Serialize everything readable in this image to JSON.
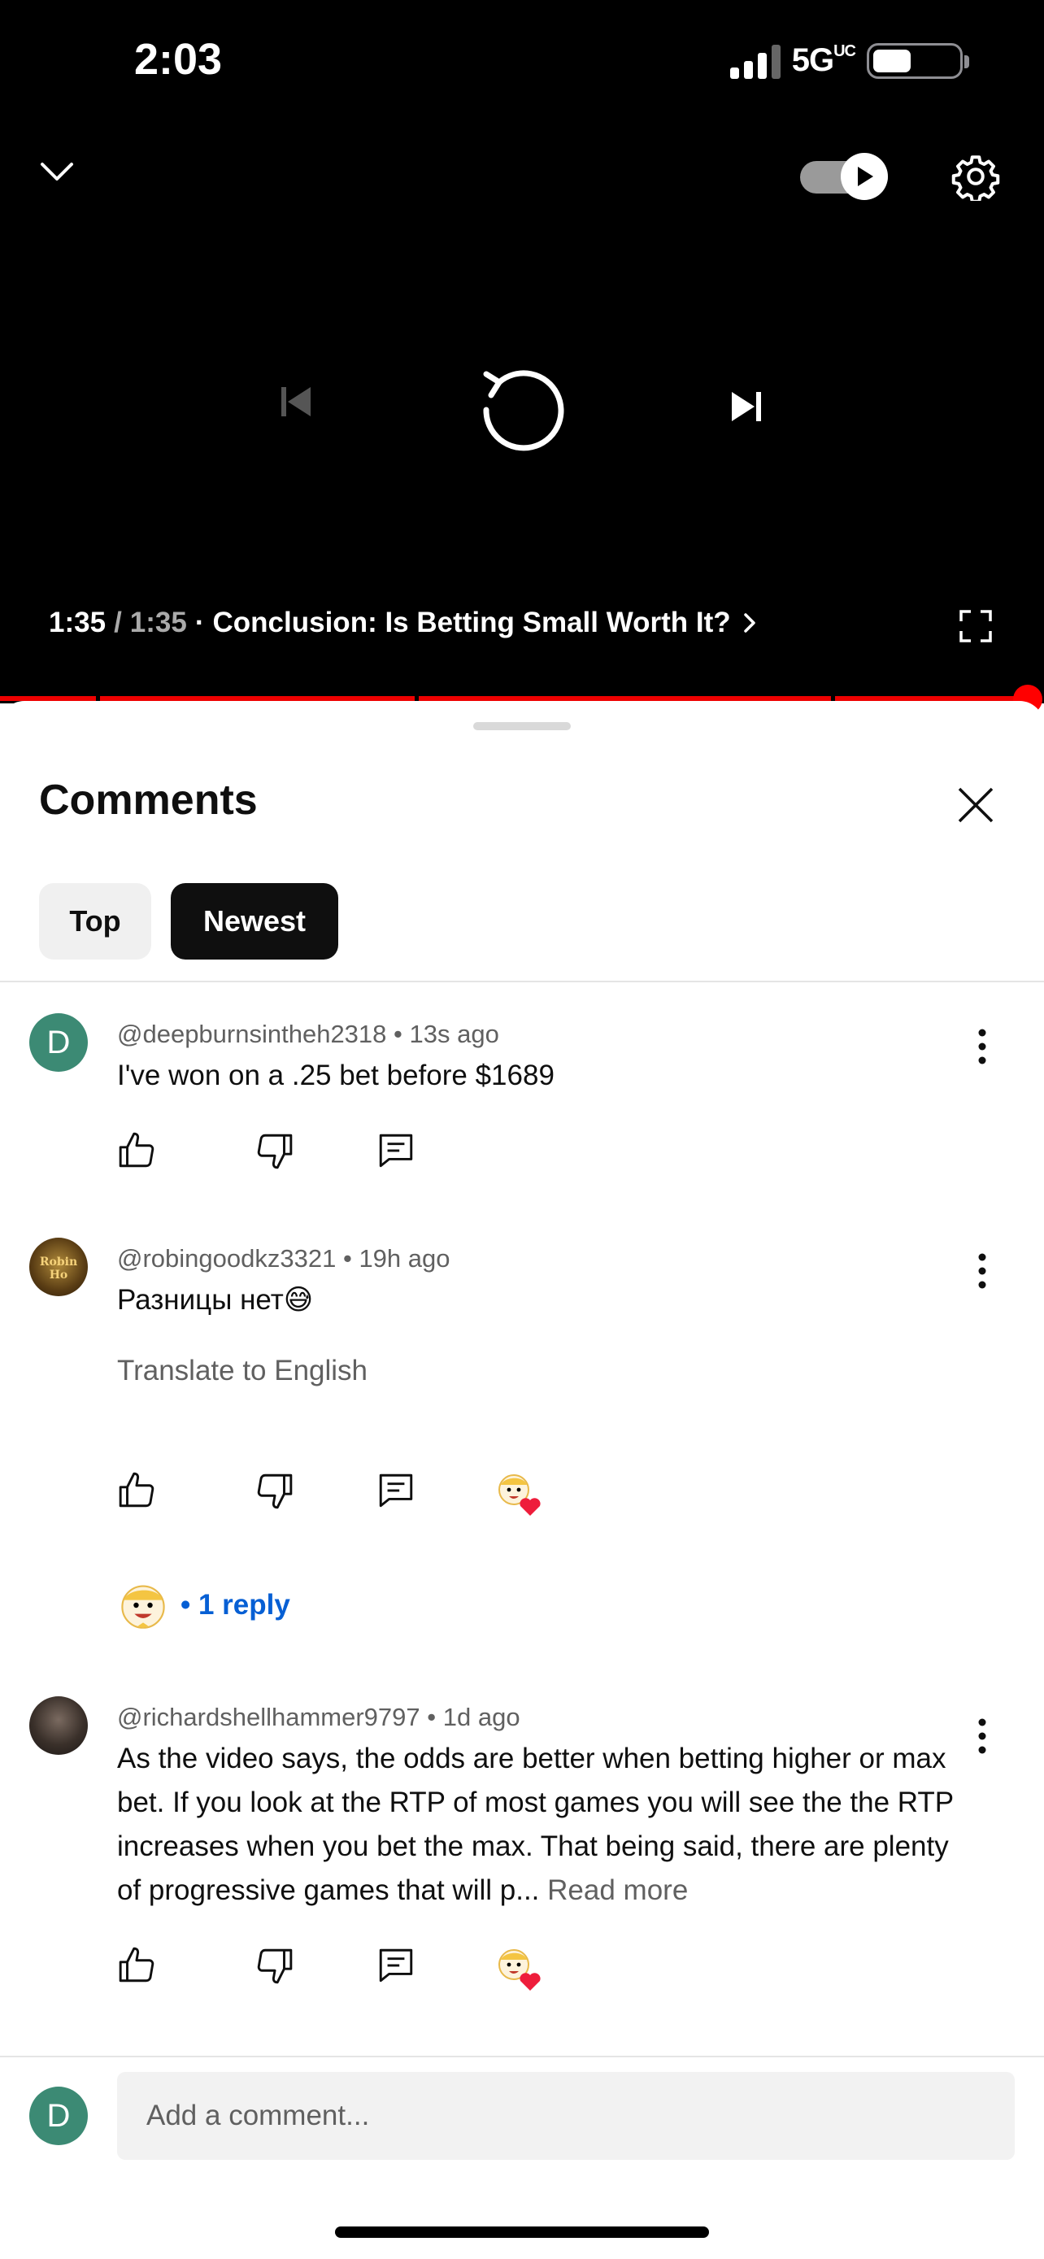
{
  "status_bar": {
    "time": "2:03",
    "network": "5G",
    "network_sub": "UC",
    "battery_level": 0.45
  },
  "player": {
    "chapter_time": "1:35",
    "slash": "/",
    "duration": "1:35",
    "separator": "·",
    "chapter_title": "Conclusion: Is Betting Small Worth It?",
    "autoplay_on": true,
    "progress_fraction": 1.0,
    "progress_color": "#ff0000"
  },
  "comments_panel": {
    "title": "Comments",
    "sort_chips": [
      "Top",
      "Newest"
    ],
    "active_sort": "Newest"
  },
  "comments": [
    {
      "author": "@deepburnsintheh2318",
      "age": "13s ago",
      "avatar_letter": "D",
      "text": "I've won on a .25 bet before $1689"
    },
    {
      "author": "@robingoodkz3321",
      "age": "19h ago",
      "avatar_text": "Robin Ho",
      "text": "Разницы нет",
      "emoji": "😅",
      "translate_label": "Translate to English",
      "creator_heart": true,
      "replies_label": "• 1 reply"
    },
    {
      "author": "@richardshellhammer9797",
      "age": "1d ago",
      "text": "As the video says, the odds are better when betting higher or max bet. If you look at the RTP of most games you will see the the RTP increases when you bet the max. That being said, there are plenty of progressive games that will p...",
      "read_more": "Read more",
      "creator_heart": true
    }
  ],
  "composer": {
    "avatar_letter": "D",
    "placeholder": "Add a comment..."
  },
  "meta_separator": "•",
  "colors": {
    "accent_red": "#ff0000",
    "link_blue": "#065fd4",
    "avatar_green": "#3c8a74"
  }
}
